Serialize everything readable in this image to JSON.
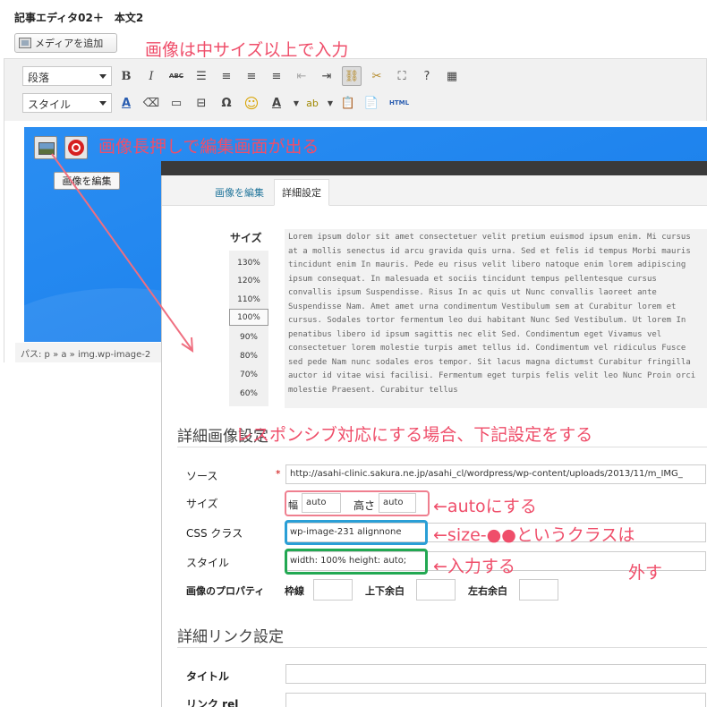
{
  "editor": {
    "title": "記事エディタ02＋　本文2",
    "media_button_label": "メディアを追加",
    "format_select": "段落",
    "style_select": "スタイル"
  },
  "toolbar_icons_row1": [
    "bold-icon",
    "italic-icon",
    "strikethrough-icon",
    "bullet-list-icon",
    "align-left-icon",
    "align-center-icon",
    "align-right-icon",
    "outdent-icon",
    "indent-icon",
    "link-icon",
    "unlink-icon",
    "fullscreen-icon",
    "help-icon",
    "toolbar-toggle-icon"
  ],
  "toolbar_icons_row2": [
    "text-color-a-icon",
    "eraser-icon",
    "horizontal-rule-icon",
    "page-break-icon",
    "omega-icon",
    "smiley-icon",
    "font-color-icon",
    "highlight-icon",
    "paste-text-icon",
    "paste-word-icon",
    "html-icon"
  ],
  "toolbar_glyphs": {
    "bold": "B",
    "italic": "I",
    "strike": "ABC",
    "omega": "Ω",
    "smiley": "☺",
    "font_color": "A",
    "html": "HTML"
  },
  "image_popup": {
    "tooltip": "画像を編集",
    "path": "パス: p » a » img.wp-image-2"
  },
  "dialog": {
    "tab_edit": "画像を編集",
    "tab_advanced": "詳細設定",
    "size_label": "サイズ",
    "size_options": [
      "130%",
      "120%",
      "110%",
      "100%",
      "90%",
      "80%",
      "70%",
      "60%"
    ],
    "size_selected": "100%",
    "lorem": "Lorem ipsum dolor sit amet consectetuer velit pretium euismod ipsum enim. Mi cursus at a mollis senectus id arcu gravida quis urna. Sed et felis id tempus Morbi mauris tincidunt enim In mauris. Pede eu risus velit libero natoque enim lorem adipiscing ipsum consequat. In malesuada et sociis tincidunt tempus pellentesque cursus convallis ipsum Suspendisse. Risus In ac quis ut Nunc convallis laoreet ante Suspendisse Nam. Amet amet urna condimentum Vestibulum sem at Curabitur lorem et cursus. Sodales tortor fermentum leo dui habitant Nunc Sed Vestibulum. Ut lorem In penatibus libero id ipsum sagittis nec elit Sed. Condimentum eget Vivamus vel consectetuer lorem molestie turpis amet tellus id. Condimentum vel ridiculus Fusce sed pede Nam nunc sodales eros tempor. Sit lacus magna dictumst Curabitur fringilla auctor id vitae wisi facilisi. Fermentum eget turpis felis velit leo Nunc Proin orci molestie Praesent. Curabitur tellus",
    "advanced_image_heading": "詳細画像設定",
    "source_label": "ソース",
    "source_required": "*",
    "source_value": "http://asahi-clinic.sakura.ne.jp/asahi_cl/wordpress/wp-content/uploads/2013/11/m_IMG_",
    "size_field_label": "サイズ",
    "width_prefix": "幅",
    "width_value": "auto",
    "height_label": "高さ",
    "height_value": "auto",
    "css_label": "CSS クラス",
    "css_value": "wp-image-231  alignnone",
    "style_label": "スタイル",
    "style_value": "width: 100% height: auto;",
    "props_label": "画像のプロパティ",
    "border_label": "枠線",
    "vspace_label": "上下余白",
    "hspace_label": "左右余白",
    "advanced_link_heading": "詳細リンク設定",
    "title_label": "タイトル",
    "rel_label": "リンク rel"
  },
  "annotations": {
    "top": "画像は中サイズ以上で入力",
    "longpress": "画像長押しで編集画面が出る",
    "responsive": "レスポンシブ対応にする場合、下記設定をする",
    "auto": "←autoにする",
    "size_class": "←size-●●というクラスは",
    "remove": "外す",
    "enter": "←入力する",
    "colors": {
      "text": "#ef4e6a",
      "pink_box": "#ef7f8f",
      "blue_box": "#2a9fd6",
      "green_box": "#22a852"
    }
  }
}
